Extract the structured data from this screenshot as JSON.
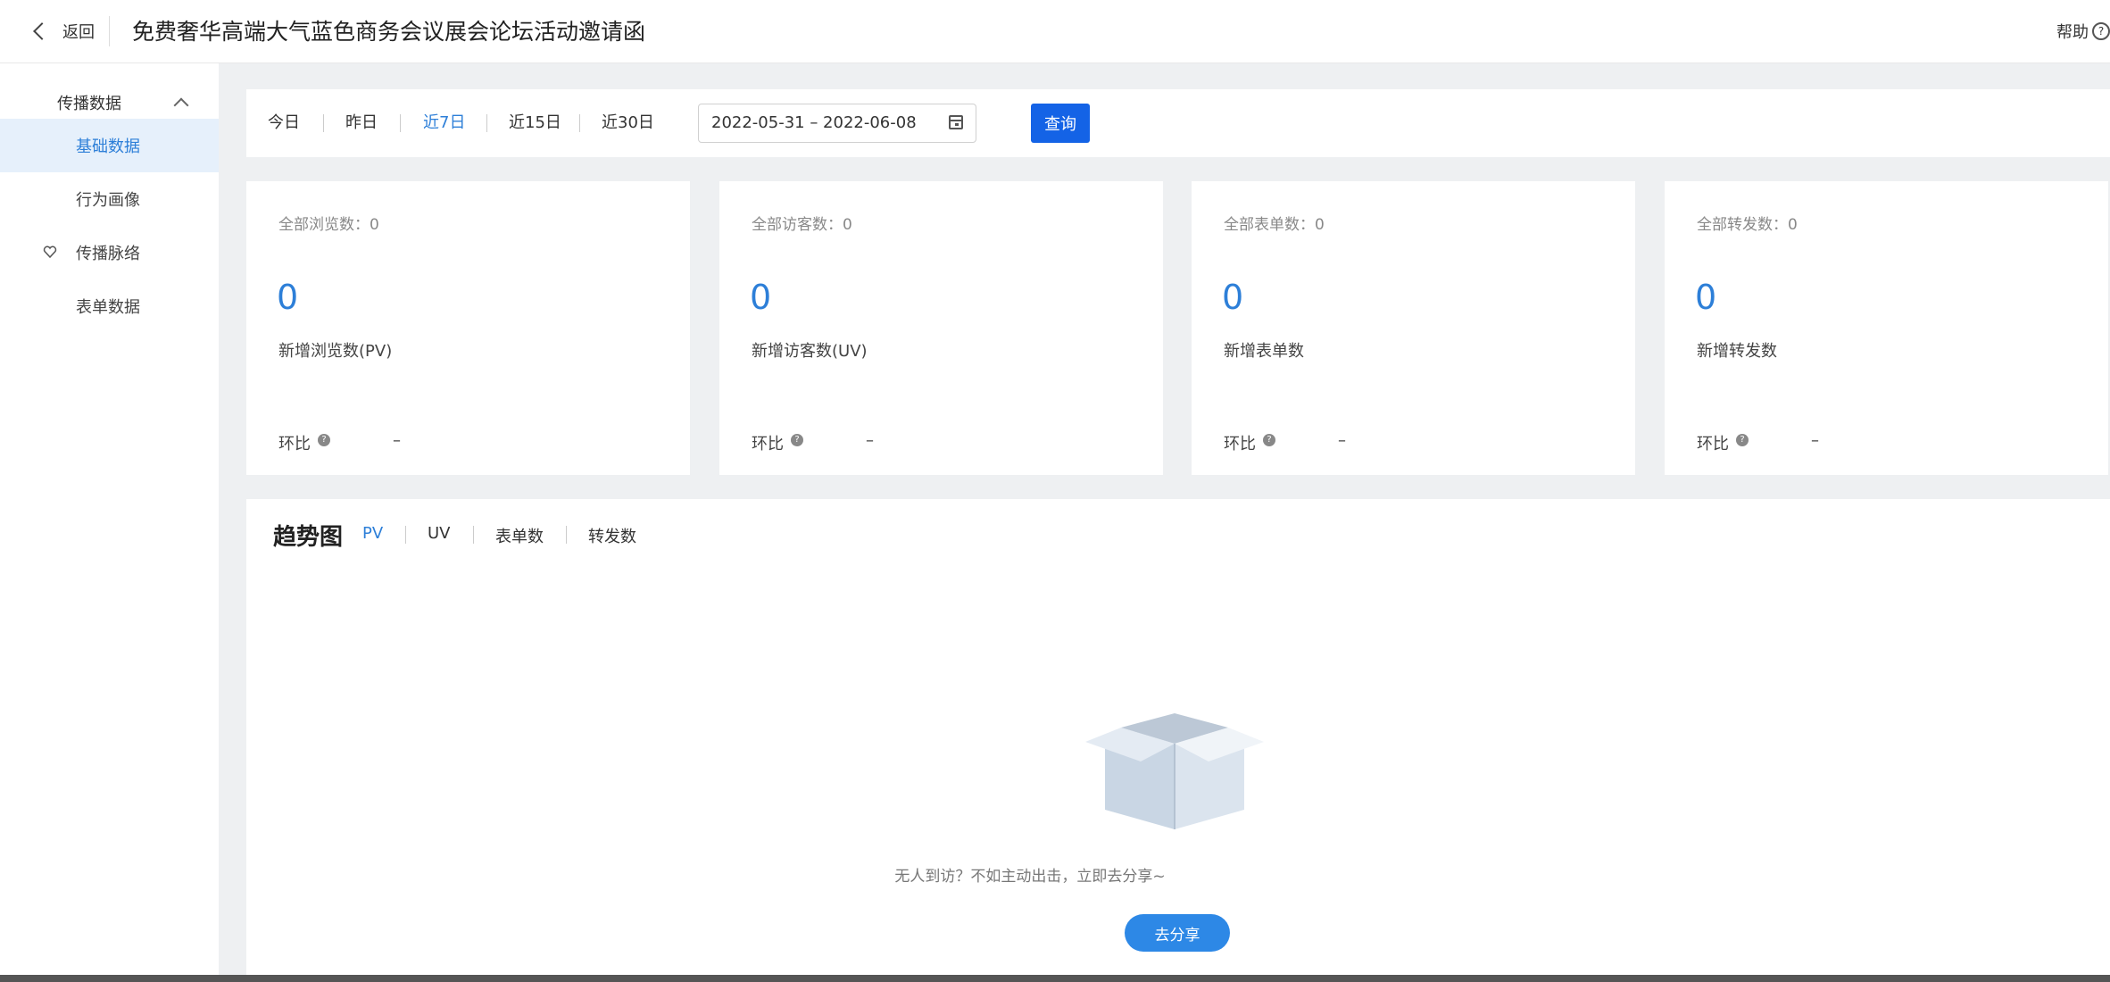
{
  "header": {
    "back_label": "返回",
    "title": "免费奢华高端大气蓝色商务会议展会论坛活动邀请函",
    "help_label": "帮助"
  },
  "sidebar": {
    "group_label": "传播数据",
    "items": [
      {
        "label": "基础数据",
        "active": true
      },
      {
        "label": "行为画像"
      },
      {
        "label": "传播脉络",
        "icon": "heart-icon"
      },
      {
        "label": "表单数据"
      }
    ]
  },
  "filters": {
    "items": [
      "今日",
      "昨日",
      "近7日",
      "近15日",
      "近30日"
    ],
    "active": "近7日",
    "date_range": "2022-05-31 – 2022-06-08",
    "query_label": "查询"
  },
  "cards": [
    {
      "total": "全部浏览数：0",
      "value": "0",
      "label": "新增浏览数(PV)",
      "ratio_label": "环比",
      "ratio_value": "–"
    },
    {
      "total": "全部访客数：0",
      "value": "0",
      "label": "新增访客数(UV)",
      "ratio_label": "环比",
      "ratio_value": "–"
    },
    {
      "total": "全部表单数：0",
      "value": "0",
      "label": "新增表单数",
      "ratio_label": "环比",
      "ratio_value": "–"
    },
    {
      "total": "全部转发数：0",
      "value": "0",
      "label": "新增转发数",
      "ratio_label": "环比",
      "ratio_value": "–"
    }
  ],
  "trend": {
    "title": "趋势图",
    "tabs": [
      "PV",
      "UV",
      "表单数",
      "转发数"
    ],
    "active_tab": "PV",
    "empty_text": "无人到访？不如主动出击，立即去分享~",
    "share_label": "去分享"
  },
  "colors": {
    "accent": "#2d7fd8",
    "query_button": "#1463e6",
    "active_bg": "#e6f0fb"
  }
}
